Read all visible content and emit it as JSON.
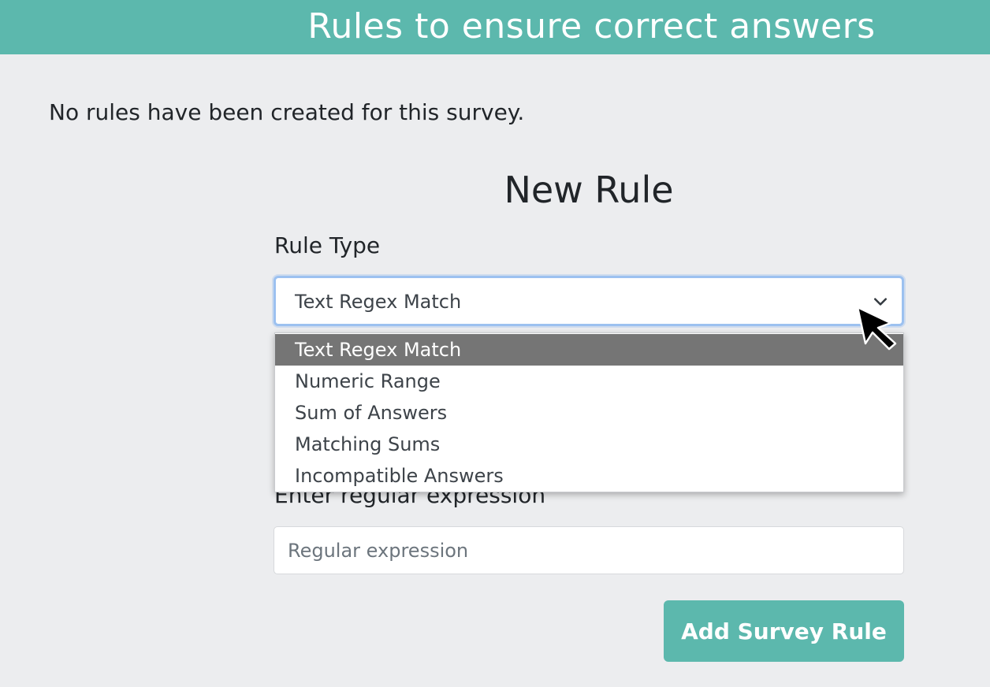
{
  "header": {
    "title": "Rules to ensure correct answers"
  },
  "main": {
    "empty_message": "No rules have been created for this survey.",
    "form": {
      "title": "New Rule",
      "rule_type_label": "Rule Type",
      "rule_type_selected": "Text Regex Match",
      "rule_type_options": [
        "Text Regex Match",
        "Numeric Range",
        "Sum of Answers",
        "Matching Sums",
        "Incompatible Answers"
      ],
      "regex_label": "Enter regular expression",
      "regex_placeholder": "Regular expression",
      "regex_value": "",
      "submit_label": "Add Survey Rule"
    }
  },
  "colors": {
    "accent": "#5cb8ad",
    "background": "#ecedef",
    "selected_option": "#757575",
    "focus_border": "#9cc1f0"
  },
  "icons": {
    "select_toggle": "chevron-down-icon",
    "pointer": "mouse-cursor-icon"
  }
}
